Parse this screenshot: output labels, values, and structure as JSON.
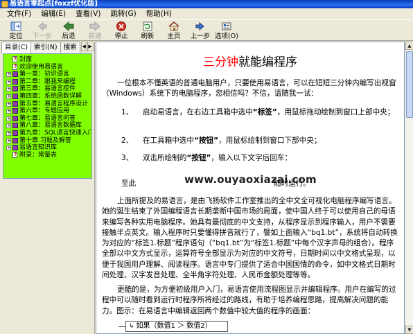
{
  "window": {
    "title": "易语言零起点[foxzf优化版]"
  },
  "menu": [
    "文件(F)",
    "编辑(E)",
    "查看(V)",
    "跳转(G)",
    "帮助(H)"
  ],
  "toolbar": [
    {
      "label": "定位",
      "icon": "locate-icon",
      "enabled": true
    },
    {
      "label": "下一步",
      "icon": "next-step-icon",
      "enabled": false
    },
    {
      "label": "后退",
      "icon": "back-arrow-icon",
      "enabled": true
    },
    {
      "label": "前进",
      "icon": "forward-arrow-icon",
      "enabled": false
    },
    {
      "label": "停止",
      "icon": "stop-icon",
      "enabled": true
    },
    {
      "label": "刷新",
      "icon": "refresh-icon",
      "enabled": true
    },
    {
      "label": "主页",
      "icon": "home-icon",
      "enabled": true
    },
    {
      "label": "上一步",
      "icon": "previous-step-icon",
      "enabled": true
    },
    {
      "label": "选项(O)",
      "icon": "options-icon",
      "enabled": true
    }
  ],
  "tabs": [
    "目录(C)",
    "索引(N)",
    "搜索"
  ],
  "tree": [
    {
      "label": "封面",
      "kind": "page",
      "expandable": false
    },
    {
      "label": "欢迎使用易语言",
      "kind": "page",
      "expandable": false
    },
    {
      "label": "第一章：初识语言",
      "kind": "book",
      "expandable": true
    },
    {
      "label": "第二章：跟我来编程",
      "kind": "book",
      "expandable": true
    },
    {
      "label": "第三章：易语言控件",
      "kind": "book",
      "expandable": true
    },
    {
      "label": "第四章：系统函数详解",
      "kind": "book",
      "expandable": true
    },
    {
      "label": "第五章：易语言程序设计",
      "kind": "book",
      "expandable": true
    },
    {
      "label": "第六章：专题应用",
      "kind": "book",
      "expandable": true
    },
    {
      "label": "第七章：易语言问答",
      "kind": "book",
      "expandable": true
    },
    {
      "label": "第八章：易语言数据库",
      "kind": "book",
      "expandable": true
    },
    {
      "label": "第九章：SQL语言快速入门",
      "kind": "book",
      "expandable": true
    },
    {
      "label": "第十章 习题及解答",
      "kind": "book",
      "expandable": true
    },
    {
      "label": "易语言知识库",
      "kind": "book",
      "expandable": true
    },
    {
      "label": "附录：常量表",
      "kind": "page",
      "expandable": false
    }
  ],
  "content": {
    "heading_red": "三分钟",
    "heading_rest": "就能编程序",
    "intro": "一位根本不懂英语的普通电脑用户，只要使用易语言，可以在短短三分钟内编写出视窗（Windows）系统下的电脑程序，您相信吗？不信，请随我一试：",
    "step1_num": "1、",
    "step1_a": "启动易语言，在右边工具箱中选中",
    "step1_b": "“标签”",
    "step1_c": "，用鼠标拖动绘制到窗口上部中央；",
    "step2_num": "2、",
    "step2_a": "在工具箱中选中",
    "step2_b": "“按钮”",
    "step2_c": "，用鼠标绘制到窗口下部中央；",
    "step3_num": "3、",
    "step3_a": "双击所绘制的",
    "step3_b": "“按钮”",
    "step3_c": "，输入以下文字后回车：",
    "code_left": "至此",
    "code_right": "随时运行。",
    "watermark": "www.ouyaoxiazai.com",
    "para2": "上面所提及的易语言，是由飞扬软件工作室推出的全中文全可视化电脑程序编写语言。她的诞生结束了外国编程语言长期垄断中国市场的局面，使中国人终于可以使用自己的母语来编写各种实用电脑程序。她具有最彻底的中文支持，从程序显示到程序输入，用户不需要接触半点英文。输入程序时只要懂得拼音就行了，譬如上面输入“bq1.bt”，系统将自动转换为对应的“标签1.标题”程序语句（“bq1.bt”为“标签1.标题”中每个汉字声母的组合）。程序全部以中文方式显示，运算符号全部显示为对应的中文符号，日期时间以中文格式呈现，以便于我国用户理解、阅读程序。语言中专门提供了适合中国国情的命令，如中文格式日期时间处理、汉字发音处理、全半角字符处理、人民币金额处理等等。",
    "para3": "更酷的是，为方便初级用户入门，易语言使用流程图显示并编辑程序。用户在编写的过程中可以随时看到运行时程序所将经过的路线，有助于培养编程思路，提高解决问题的能力。图示：在易语言中编辑返回两个数值中较大值的程序的画面：",
    "if_box": "如果（数值1 ＞ 数值2）"
  }
}
